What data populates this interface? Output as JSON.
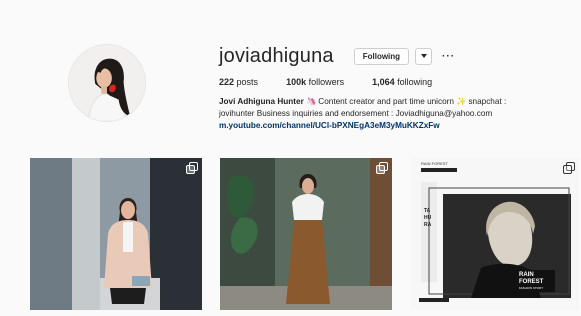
{
  "profile": {
    "username": "joviadhiguna",
    "follow_button": "Following",
    "more_label": "···",
    "stats": [
      {
        "value": "222",
        "label": "posts"
      },
      {
        "value": "100k",
        "label": "followers"
      },
      {
        "value": "1,064",
        "label": "following"
      }
    ],
    "bio": {
      "full_name": "Jovi Adhiguna Hunter",
      "line1_text": "Content creator and part time unicorn",
      "line1_tail": "snapchat :",
      "line2": "jovihunter Business inquiries and endorsement : Joviadhiguna@yahoo.com",
      "link": "m.youtube.com/channel/UCl-bPXNEgA3eM3yMuKKZxFw"
    },
    "emoji": {
      "unicorn": "🦄",
      "sparkles": "✨"
    }
  },
  "posts": [
    {
      "name": "post-1",
      "multi": true,
      "ad": null
    },
    {
      "name": "post-2",
      "multi": true,
      "ad": null
    },
    {
      "name": "post-3",
      "multi": true,
      "ad": {
        "corner_tag": "RAIN FOREST",
        "side_letters": [
          "TA",
          "HU",
          "RA"
        ],
        "brand": "RAIN FOREST",
        "brand_sub": "FASHION STORY"
      }
    }
  ],
  "colors": {
    "link": "#003569",
    "text": "#262626",
    "background": "#fafafa"
  }
}
